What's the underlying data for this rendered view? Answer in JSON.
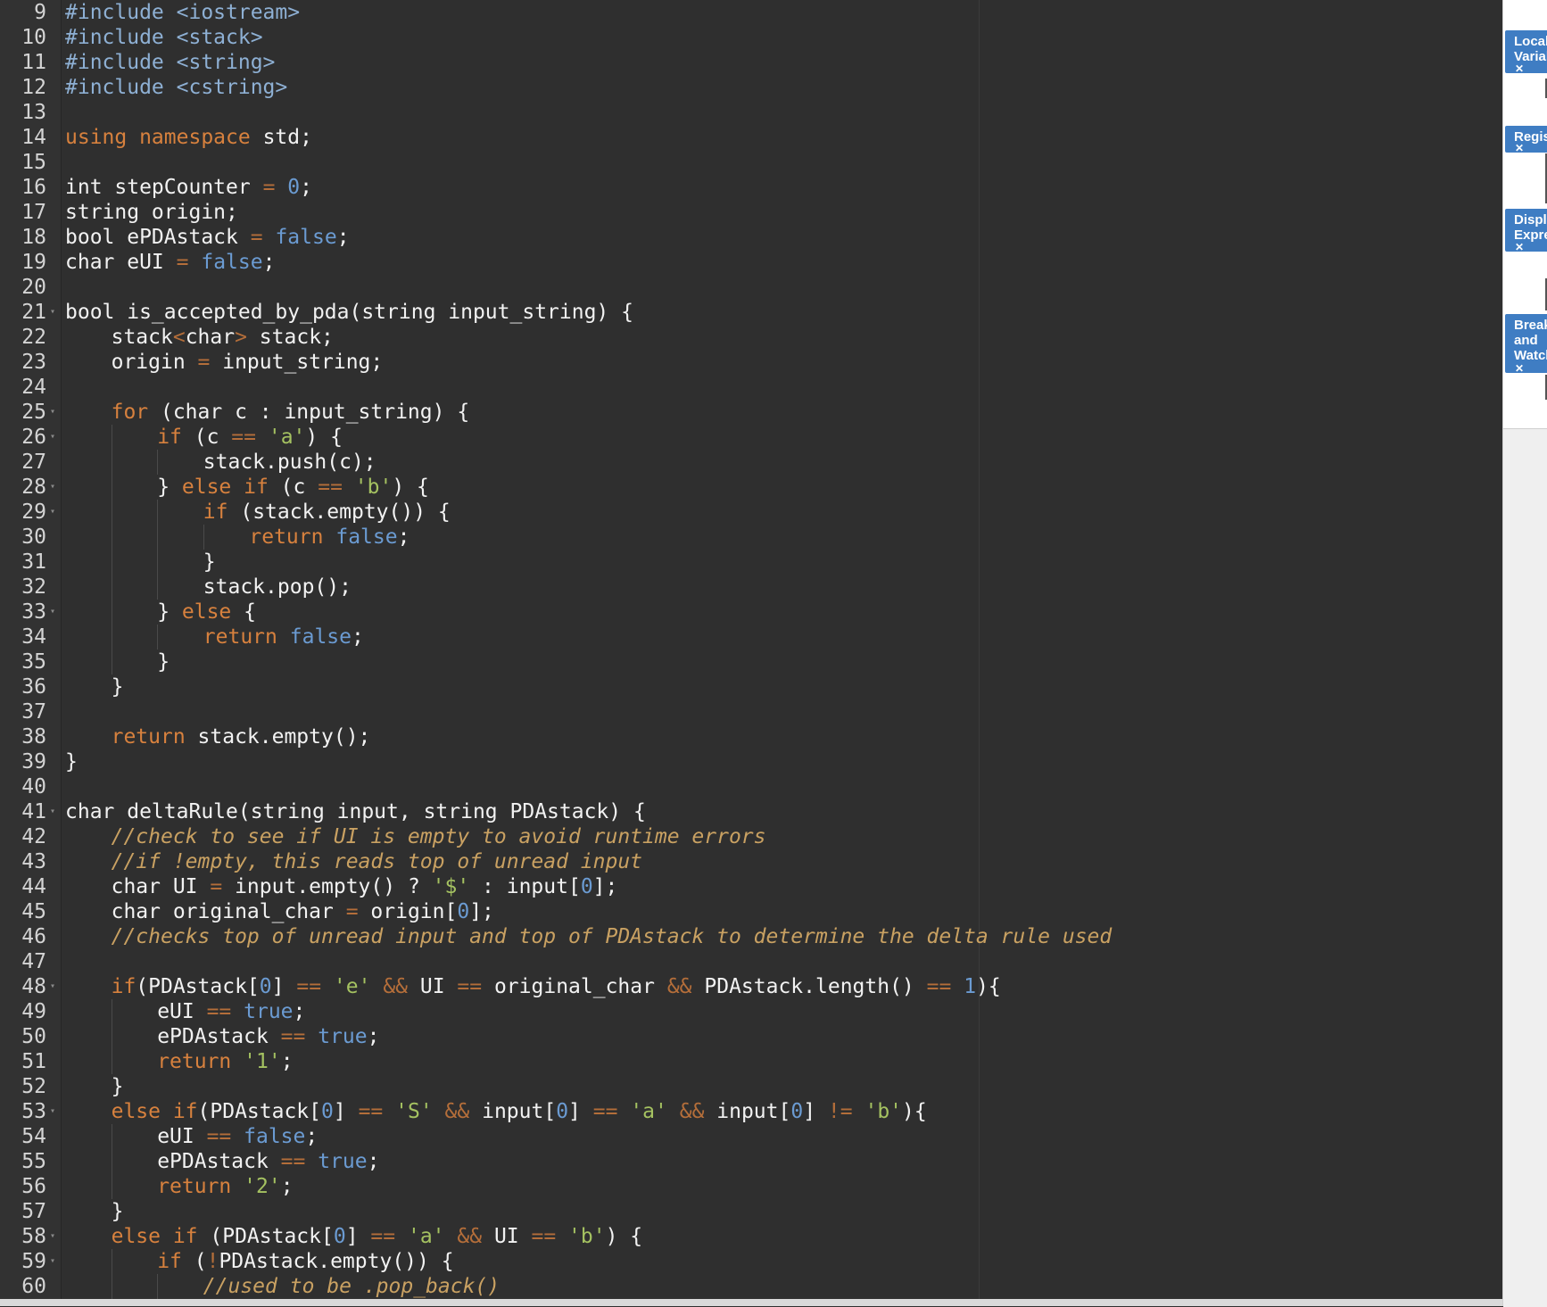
{
  "editor": {
    "lines": [
      {
        "n": "9",
        "i": 0,
        "f": false,
        "t": [
          [
            "inc",
            "#include <iostream>"
          ]
        ]
      },
      {
        "n": "10",
        "i": 0,
        "f": false,
        "t": [
          [
            "inc",
            "#include <stack>"
          ]
        ]
      },
      {
        "n": "11",
        "i": 0,
        "f": false,
        "t": [
          [
            "inc",
            "#include <string>"
          ]
        ]
      },
      {
        "n": "12",
        "i": 0,
        "f": false,
        "t": [
          [
            "inc",
            "#include <cstring>"
          ]
        ]
      },
      {
        "n": "13",
        "i": 0,
        "f": false,
        "t": []
      },
      {
        "n": "14",
        "i": 0,
        "f": false,
        "t": [
          [
            "kw",
            "using namespace"
          ],
          [
            "p",
            " std;"
          ]
        ]
      },
      {
        "n": "15",
        "i": 0,
        "f": false,
        "t": []
      },
      {
        "n": "16",
        "i": 0,
        "f": false,
        "t": [
          [
            "p",
            "int stepCounter "
          ],
          [
            "op",
            "="
          ],
          [
            "p",
            " "
          ],
          [
            "num",
            "0"
          ],
          [
            "p",
            ";"
          ]
        ]
      },
      {
        "n": "17",
        "i": 0,
        "f": false,
        "t": [
          [
            "p",
            "string origin;"
          ]
        ]
      },
      {
        "n": "18",
        "i": 0,
        "f": false,
        "t": [
          [
            "p",
            "bool ePDAstack "
          ],
          [
            "op",
            "="
          ],
          [
            "p",
            " "
          ],
          [
            "bool",
            "false"
          ],
          [
            "p",
            ";"
          ]
        ]
      },
      {
        "n": "19",
        "i": 0,
        "f": false,
        "t": [
          [
            "p",
            "char eUI "
          ],
          [
            "op",
            "="
          ],
          [
            "p",
            " "
          ],
          [
            "bool",
            "false"
          ],
          [
            "p",
            ";"
          ]
        ]
      },
      {
        "n": "20",
        "i": 0,
        "f": false,
        "t": []
      },
      {
        "n": "21",
        "i": 0,
        "f": true,
        "t": [
          [
            "p",
            "bool is_accepted_by_pda(string input_string) {"
          ]
        ]
      },
      {
        "n": "22",
        "i": 1,
        "f": false,
        "t": [
          [
            "p",
            "stack"
          ],
          [
            "op",
            "<"
          ],
          [
            "p",
            "char"
          ],
          [
            "op",
            ">"
          ],
          [
            "p",
            " stack;"
          ]
        ]
      },
      {
        "n": "23",
        "i": 1,
        "f": false,
        "t": [
          [
            "p",
            "origin "
          ],
          [
            "op",
            "="
          ],
          [
            "p",
            " input_string;"
          ]
        ]
      },
      {
        "n": "24",
        "i": 0,
        "f": false,
        "t": []
      },
      {
        "n": "25",
        "i": 1,
        "f": true,
        "t": [
          [
            "kw",
            "for"
          ],
          [
            "p",
            " (char c : input_string) {"
          ]
        ]
      },
      {
        "n": "26",
        "i": 2,
        "f": true,
        "t": [
          [
            "kw",
            "if"
          ],
          [
            "p",
            " (c "
          ],
          [
            "op",
            "=="
          ],
          [
            "p",
            " "
          ],
          [
            "str",
            "'a'"
          ],
          [
            "p",
            ") {"
          ]
        ]
      },
      {
        "n": "27",
        "i": 3,
        "f": false,
        "t": [
          [
            "p",
            "stack.push(c);"
          ]
        ]
      },
      {
        "n": "28",
        "i": 2,
        "f": true,
        "t": [
          [
            "p",
            "} "
          ],
          [
            "kw",
            "else if"
          ],
          [
            "p",
            " (c "
          ],
          [
            "op",
            "=="
          ],
          [
            "p",
            " "
          ],
          [
            "str",
            "'b'"
          ],
          [
            "p",
            ") {"
          ]
        ]
      },
      {
        "n": "29",
        "i": 3,
        "f": true,
        "t": [
          [
            "kw",
            "if"
          ],
          [
            "p",
            " (stack.empty()) {"
          ]
        ]
      },
      {
        "n": "30",
        "i": 4,
        "f": false,
        "t": [
          [
            "kw",
            "return"
          ],
          [
            "p",
            " "
          ],
          [
            "bool",
            "false"
          ],
          [
            "p",
            ";"
          ]
        ]
      },
      {
        "n": "31",
        "i": 3,
        "f": false,
        "t": [
          [
            "p",
            "}"
          ]
        ]
      },
      {
        "n": "32",
        "i": 3,
        "f": false,
        "t": [
          [
            "p",
            "stack.pop();"
          ]
        ]
      },
      {
        "n": "33",
        "i": 2,
        "f": true,
        "t": [
          [
            "p",
            "} "
          ],
          [
            "kw",
            "else"
          ],
          [
            "p",
            " {"
          ]
        ]
      },
      {
        "n": "34",
        "i": 3,
        "f": false,
        "t": [
          [
            "kw",
            "return"
          ],
          [
            "p",
            " "
          ],
          [
            "bool",
            "false"
          ],
          [
            "p",
            ";"
          ]
        ]
      },
      {
        "n": "35",
        "i": 2,
        "f": false,
        "t": [
          [
            "p",
            "}"
          ]
        ]
      },
      {
        "n": "36",
        "i": 1,
        "f": false,
        "t": [
          [
            "p",
            "}"
          ]
        ]
      },
      {
        "n": "37",
        "i": 0,
        "f": false,
        "t": []
      },
      {
        "n": "38",
        "i": 1,
        "f": false,
        "t": [
          [
            "kw",
            "return"
          ],
          [
            "p",
            " stack.empty();"
          ]
        ]
      },
      {
        "n": "39",
        "i": 0,
        "f": false,
        "t": [
          [
            "p",
            "}"
          ]
        ]
      },
      {
        "n": "40",
        "i": 0,
        "f": false,
        "t": []
      },
      {
        "n": "41",
        "i": 0,
        "f": true,
        "t": [
          [
            "p",
            "char deltaRule(string input, string PDAstack) {"
          ]
        ]
      },
      {
        "n": "42",
        "i": 1,
        "f": false,
        "t": [
          [
            "cmt",
            "//check to see if UI is empty to avoid runtime errors"
          ]
        ]
      },
      {
        "n": "43",
        "i": 1,
        "f": false,
        "t": [
          [
            "cmt",
            "//if !empty, this reads top of unread input"
          ]
        ]
      },
      {
        "n": "44",
        "i": 1,
        "f": false,
        "t": [
          [
            "p",
            "char UI "
          ],
          [
            "op",
            "="
          ],
          [
            "p",
            " input.empty() ? "
          ],
          [
            "str",
            "'$'"
          ],
          [
            "p",
            " : input["
          ],
          [
            "num",
            "0"
          ],
          [
            "p",
            "];"
          ]
        ]
      },
      {
        "n": "45",
        "i": 1,
        "f": false,
        "t": [
          [
            "p",
            "char original_char "
          ],
          [
            "op",
            "="
          ],
          [
            "p",
            " origin["
          ],
          [
            "num",
            "0"
          ],
          [
            "p",
            "];"
          ]
        ]
      },
      {
        "n": "46",
        "i": 1,
        "f": false,
        "t": [
          [
            "cmt",
            "//checks top of unread input and top of PDAstack to determine the delta rule used"
          ]
        ]
      },
      {
        "n": "47",
        "i": 0,
        "f": false,
        "t": []
      },
      {
        "n": "48",
        "i": 1,
        "f": true,
        "t": [
          [
            "kw",
            "if"
          ],
          [
            "p",
            "(PDAstack["
          ],
          [
            "num",
            "0"
          ],
          [
            "p",
            "] "
          ],
          [
            "op",
            "=="
          ],
          [
            "p",
            " "
          ],
          [
            "str",
            "'e'"
          ],
          [
            "p",
            " "
          ],
          [
            "op",
            "&&"
          ],
          [
            "p",
            " UI "
          ],
          [
            "op",
            "=="
          ],
          [
            "p",
            " original_char "
          ],
          [
            "op",
            "&&"
          ],
          [
            "p",
            " PDAstack.length() "
          ],
          [
            "op",
            "=="
          ],
          [
            "p",
            " "
          ],
          [
            "num",
            "1"
          ],
          [
            "p",
            "){"
          ]
        ]
      },
      {
        "n": "49",
        "i": 2,
        "f": false,
        "t": [
          [
            "p",
            "eUI "
          ],
          [
            "op",
            "=="
          ],
          [
            "p",
            " "
          ],
          [
            "bool",
            "true"
          ],
          [
            "p",
            ";"
          ]
        ]
      },
      {
        "n": "50",
        "i": 2,
        "f": false,
        "t": [
          [
            "p",
            "ePDAstack "
          ],
          [
            "op",
            "=="
          ],
          [
            "p",
            " "
          ],
          [
            "bool",
            "true"
          ],
          [
            "p",
            ";"
          ]
        ]
      },
      {
        "n": "51",
        "i": 2,
        "f": false,
        "t": [
          [
            "kw",
            "return"
          ],
          [
            "p",
            " "
          ],
          [
            "str",
            "'1'"
          ],
          [
            "p",
            ";"
          ]
        ]
      },
      {
        "n": "52",
        "i": 1,
        "f": false,
        "t": [
          [
            "p",
            "}"
          ]
        ]
      },
      {
        "n": "53",
        "i": 1,
        "f": true,
        "t": [
          [
            "kw",
            "else if"
          ],
          [
            "p",
            "(PDAstack["
          ],
          [
            "num",
            "0"
          ],
          [
            "p",
            "] "
          ],
          [
            "op",
            "=="
          ],
          [
            "p",
            " "
          ],
          [
            "str",
            "'S'"
          ],
          [
            "p",
            " "
          ],
          [
            "op",
            "&&"
          ],
          [
            "p",
            " input["
          ],
          [
            "num",
            "0"
          ],
          [
            "p",
            "] "
          ],
          [
            "op",
            "=="
          ],
          [
            "p",
            " "
          ],
          [
            "str",
            "'a'"
          ],
          [
            "p",
            " "
          ],
          [
            "op",
            "&&"
          ],
          [
            "p",
            " input["
          ],
          [
            "num",
            "0"
          ],
          [
            "p",
            "] "
          ],
          [
            "op",
            "!="
          ],
          [
            "p",
            " "
          ],
          [
            "str",
            "'b'"
          ],
          [
            "p",
            "){"
          ]
        ]
      },
      {
        "n": "54",
        "i": 2,
        "f": false,
        "t": [
          [
            "p",
            "eUI "
          ],
          [
            "op",
            "=="
          ],
          [
            "p",
            " "
          ],
          [
            "bool",
            "false"
          ],
          [
            "p",
            ";"
          ]
        ]
      },
      {
        "n": "55",
        "i": 2,
        "f": false,
        "t": [
          [
            "p",
            "ePDAstack "
          ],
          [
            "op",
            "=="
          ],
          [
            "p",
            " "
          ],
          [
            "bool",
            "true"
          ],
          [
            "p",
            ";"
          ]
        ]
      },
      {
        "n": "56",
        "i": 2,
        "f": false,
        "t": [
          [
            "kw",
            "return"
          ],
          [
            "p",
            " "
          ],
          [
            "str",
            "'2'"
          ],
          [
            "p",
            ";"
          ]
        ]
      },
      {
        "n": "57",
        "i": 1,
        "f": false,
        "t": [
          [
            "p",
            "}"
          ]
        ]
      },
      {
        "n": "58",
        "i": 1,
        "f": true,
        "t": [
          [
            "kw",
            "else if"
          ],
          [
            "p",
            " (PDAstack["
          ],
          [
            "num",
            "0"
          ],
          [
            "p",
            "] "
          ],
          [
            "op",
            "=="
          ],
          [
            "p",
            " "
          ],
          [
            "str",
            "'a'"
          ],
          [
            "p",
            " "
          ],
          [
            "op",
            "&&"
          ],
          [
            "p",
            " UI "
          ],
          [
            "op",
            "=="
          ],
          [
            "p",
            " "
          ],
          [
            "str",
            "'b'"
          ],
          [
            "p",
            ") {"
          ]
        ]
      },
      {
        "n": "59",
        "i": 2,
        "f": true,
        "t": [
          [
            "kw",
            "if"
          ],
          [
            "p",
            " ("
          ],
          [
            "op",
            "!"
          ],
          [
            "p",
            "PDAstack.empty()) {"
          ]
        ]
      },
      {
        "n": "60",
        "i": 3,
        "f": false,
        "t": [
          [
            "cmt",
            "//used to be .pop_back()"
          ]
        ]
      }
    ]
  },
  "side_panel": {
    "tabs": [
      {
        "name": "local-variables",
        "lines": [
          "Local",
          "Variables"
        ]
      },
      {
        "name": "registers",
        "lines": [
          "Registers"
        ]
      },
      {
        "name": "display-expressions",
        "lines": [
          "Display",
          "Expressions"
        ]
      },
      {
        "name": "breakpoints-and-watchpoints",
        "lines": [
          "Breakpoints",
          "and",
          "Watchpoints"
        ]
      }
    ],
    "close_glyph": "✕"
  },
  "colors": {
    "editor_bg": "#2f2f2f",
    "keyword": "#d7813e",
    "string": "#a5c261",
    "number": "#6b9bd2",
    "comment": "#c9a162",
    "tab_blue": "#3f7dc3"
  }
}
